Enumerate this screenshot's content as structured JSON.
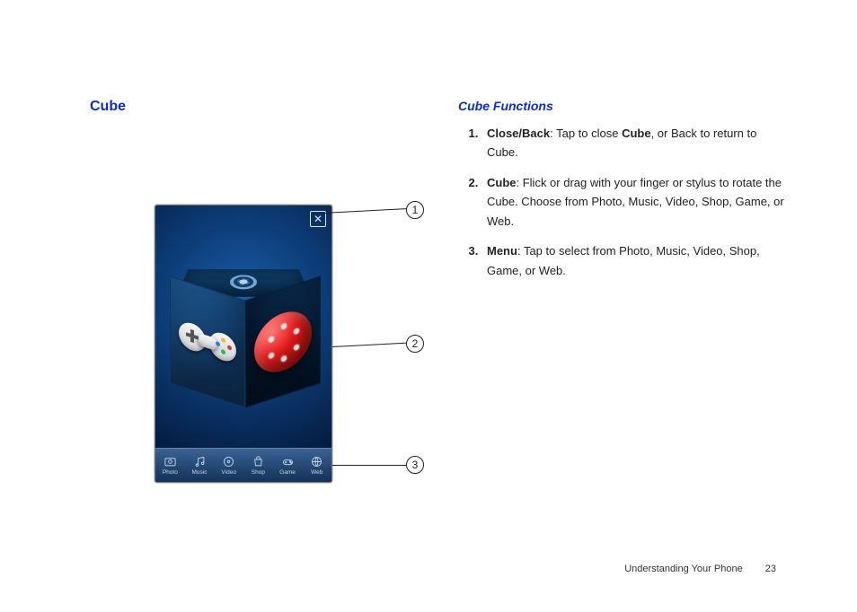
{
  "left": {
    "heading": "Cube",
    "close_label": "✕",
    "callouts": {
      "n1": "1",
      "n2": "2",
      "n3": "3"
    },
    "menu": [
      {
        "label": "Photo",
        "icon": "photo-icon"
      },
      {
        "label": "Music",
        "icon": "music-icon"
      },
      {
        "label": "Video",
        "icon": "video-icon"
      },
      {
        "label": "Shop",
        "icon": "shop-icon"
      },
      {
        "label": "Game",
        "icon": "game-icon"
      },
      {
        "label": "Web",
        "icon": "web-icon"
      }
    ]
  },
  "right": {
    "subheading": "Cube Functions",
    "items": [
      {
        "term": "Close/Back",
        "text_a": ": Tap to close ",
        "bold_a": "Cube",
        "text_b": ", or  Back to return to Cube."
      },
      {
        "term": "Cube",
        "text_a": ": Flick or drag with your finger or stylus to rotate the Cube.  Choose from Photo, Music, Video, Shop, Game, or Web.",
        "bold_a": "",
        "text_b": ""
      },
      {
        "term": "Menu",
        "text_a": ": Tap to select from Photo, Music, Video, Shop, Game, or Web.",
        "bold_a": "",
        "text_b": ""
      }
    ]
  },
  "footer": {
    "section": "Understanding Your Phone",
    "page": "23"
  }
}
